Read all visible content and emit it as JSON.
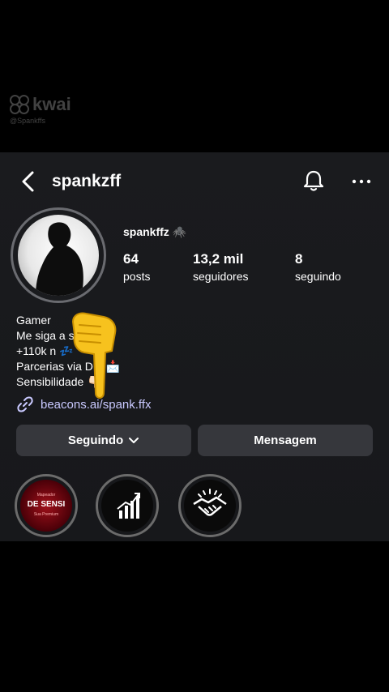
{
  "watermark": {
    "brand": "kwai",
    "handle": "@Spankffs"
  },
  "header": {
    "username": "spankzff"
  },
  "profile": {
    "display_name": "spankffz 🕷️",
    "stats": [
      {
        "value": "64",
        "label": "posts"
      },
      {
        "value": "13,2 mil",
        "label": "seguidores"
      },
      {
        "value": "8",
        "label": "seguindo"
      }
    ],
    "bio_lines": [
      "Gamer",
      "Me siga        a sensi 🖤",
      "+110k n        💤",
      "Parcerias via DM 📩",
      "Sensibilidade 👇🏻"
    ],
    "link": "beacons.ai/spank.ffx"
  },
  "buttons": {
    "following": "Seguindo",
    "message": "Mensagem"
  },
  "highlights": [
    {
      "icon": "sensi-cover",
      "top": "Mapeador",
      "main": "DE SENSI",
      "bottom": "Sua Premium"
    },
    {
      "icon": "chart-bars-icon"
    },
    {
      "icon": "handshake-icon"
    }
  ],
  "colors": {
    "panel": "#1a1b1e",
    "button": "#36373c",
    "link": "#c9c9ff",
    "sensi": "#a0101a"
  }
}
